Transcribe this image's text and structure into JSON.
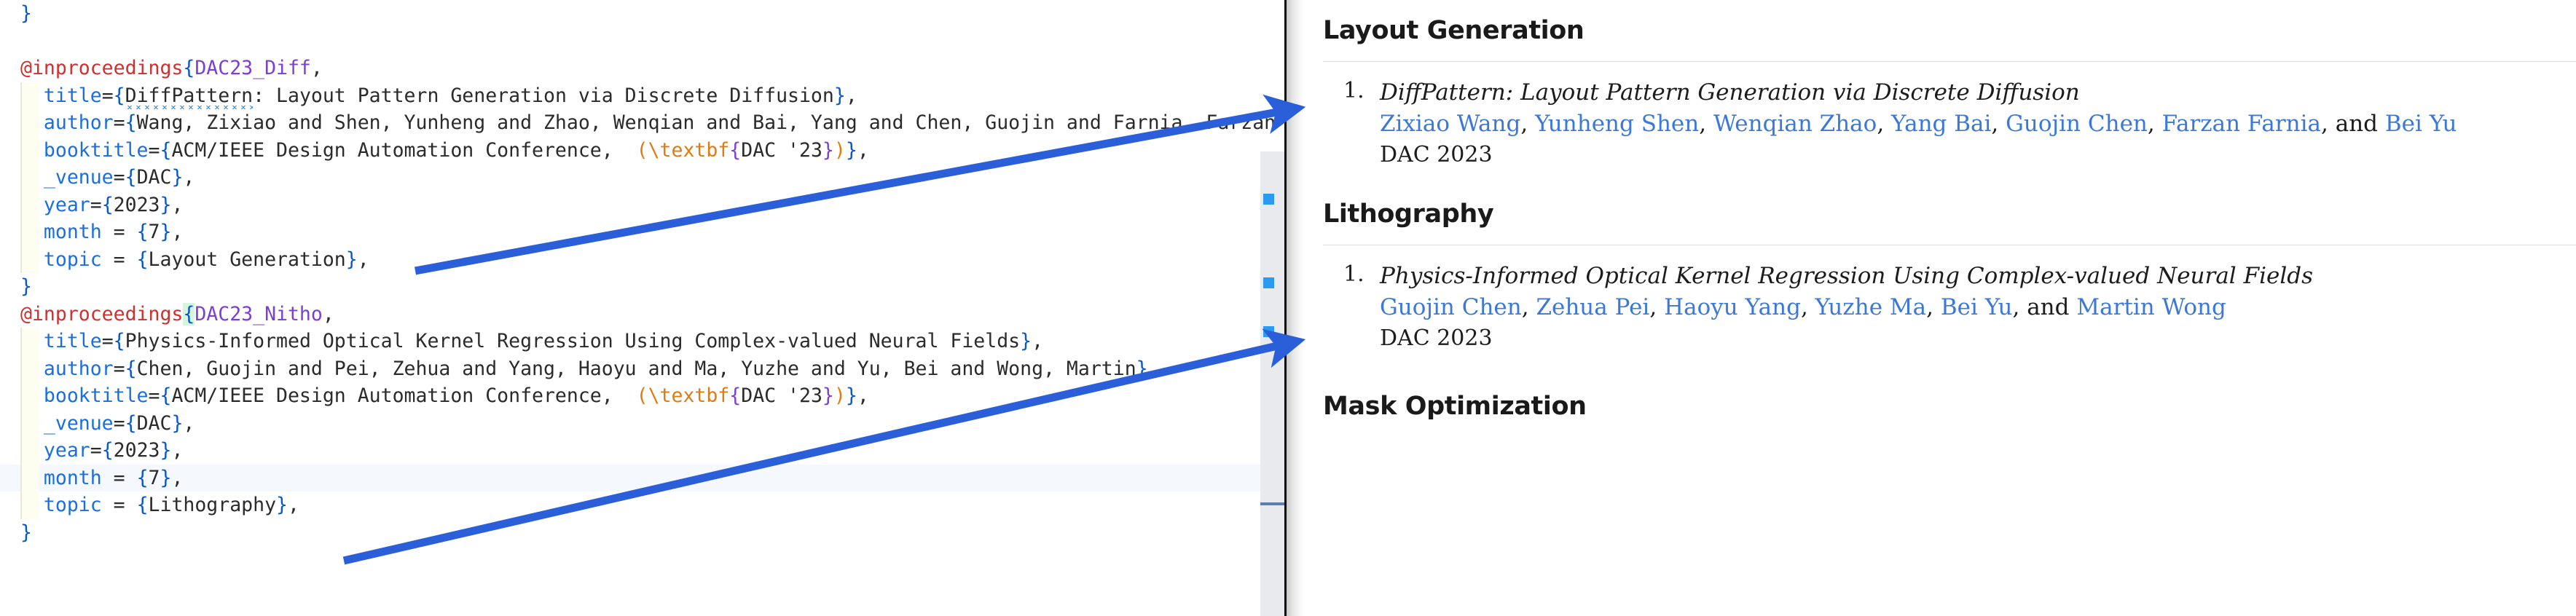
{
  "editor": {
    "entries": [
      {
        "stray_brace": "}",
        "lines": []
      }
    ],
    "code_lines": [
      {
        "id": "l0",
        "block": false,
        "selected": false,
        "segs": [
          {
            "c": "tk-brace",
            "t": "}"
          }
        ]
      },
      {
        "id": "l1",
        "block": false,
        "selected": false,
        "segs": []
      },
      {
        "id": "l2",
        "block": false,
        "selected": false,
        "segs": [
          {
            "c": "tk-at",
            "t": "@inproceedings"
          },
          {
            "c": "tk-brace",
            "t": "{"
          },
          {
            "c": "tk-key",
            "t": "DAC23_Diff"
          },
          {
            "c": "tk-plain",
            "t": ","
          }
        ]
      },
      {
        "id": "l3",
        "block": true,
        "selected": false,
        "segs": [
          {
            "c": "tk-field",
            "t": "  title"
          },
          {
            "c": "tk-plain",
            "t": "="
          },
          {
            "c": "tk-brace",
            "t": "{"
          },
          {
            "c": "tk-plain squiggle",
            "t": "DiffPattern"
          },
          {
            "c": "tk-plain",
            "t": ": Layout Pattern Generation via Discrete Diffusion"
          },
          {
            "c": "tk-brace",
            "t": "}"
          },
          {
            "c": "tk-plain",
            "t": ","
          }
        ]
      },
      {
        "id": "l4",
        "block": true,
        "selected": false,
        "segs": [
          {
            "c": "tk-field",
            "t": "  author"
          },
          {
            "c": "tk-plain",
            "t": "="
          },
          {
            "c": "tk-brace",
            "t": "{"
          },
          {
            "c": "tk-plain",
            "t": "Wang, Zixiao and Shen, Yunheng and Zhao, Wenqian and Bai, Yang and Chen, Guojin and Farnia, Farzan and Yu, Bei"
          },
          {
            "c": "tk-brace",
            "t": "}"
          },
          {
            "c": "tk-plain",
            "t": ","
          }
        ]
      },
      {
        "id": "l5",
        "block": true,
        "selected": false,
        "segs": [
          {
            "c": "tk-field",
            "t": "  booktitle"
          },
          {
            "c": "tk-plain",
            "t": "="
          },
          {
            "c": "tk-brace",
            "t": "{"
          },
          {
            "c": "tk-plain",
            "t": "ACM/IEEE Design Automation Conference,  "
          },
          {
            "c": "tk-cmd",
            "t": "(\\textbf"
          },
          {
            "c": "tk-tbrace",
            "t": "{"
          },
          {
            "c": "tk-plain",
            "t": "DAC '23"
          },
          {
            "c": "tk-tbrace",
            "t": "}"
          },
          {
            "c": "tk-cmd",
            "t": ")"
          },
          {
            "c": "tk-brace",
            "t": "}"
          },
          {
            "c": "tk-plain",
            "t": ","
          }
        ]
      },
      {
        "id": "l6",
        "block": true,
        "selected": false,
        "segs": [
          {
            "c": "tk-field",
            "t": "  _venue"
          },
          {
            "c": "tk-plain",
            "t": "="
          },
          {
            "c": "tk-brace",
            "t": "{"
          },
          {
            "c": "tk-plain",
            "t": "DAC"
          },
          {
            "c": "tk-brace",
            "t": "}"
          },
          {
            "c": "tk-plain",
            "t": ","
          }
        ]
      },
      {
        "id": "l7",
        "block": true,
        "selected": false,
        "segs": [
          {
            "c": "tk-field",
            "t": "  year"
          },
          {
            "c": "tk-plain",
            "t": "="
          },
          {
            "c": "tk-brace",
            "t": "{"
          },
          {
            "c": "tk-plain",
            "t": "2023"
          },
          {
            "c": "tk-brace",
            "t": "}"
          },
          {
            "c": "tk-plain",
            "t": ","
          }
        ]
      },
      {
        "id": "l8",
        "block": true,
        "selected": false,
        "segs": [
          {
            "c": "tk-field",
            "t": "  month"
          },
          {
            "c": "tk-plain",
            "t": " = "
          },
          {
            "c": "tk-brace",
            "t": "{"
          },
          {
            "c": "tk-plain",
            "t": "7"
          },
          {
            "c": "tk-brace",
            "t": "}"
          },
          {
            "c": "tk-plain",
            "t": ","
          }
        ]
      },
      {
        "id": "l9",
        "block": true,
        "selected": false,
        "segs": [
          {
            "c": "tk-field",
            "t": "  topic"
          },
          {
            "c": "tk-plain",
            "t": " = "
          },
          {
            "c": "tk-brace",
            "t": "{"
          },
          {
            "c": "tk-plain",
            "t": "Layout Generation"
          },
          {
            "c": "tk-brace",
            "t": "}"
          },
          {
            "c": "tk-plain",
            "t": ","
          }
        ]
      },
      {
        "id": "l10",
        "block": false,
        "selected": false,
        "segs": [
          {
            "c": "tk-brace",
            "t": "}"
          }
        ]
      },
      {
        "id": "l11",
        "block": false,
        "selected": false,
        "segs": [
          {
            "c": "tk-at",
            "t": "@inproceedings"
          },
          {
            "c": "tk-brace cursor-hl",
            "t": "{"
          },
          {
            "c": "tk-key",
            "t": "DAC23_Nitho"
          },
          {
            "c": "tk-plain",
            "t": ","
          }
        ]
      },
      {
        "id": "l12",
        "block": true,
        "selected": false,
        "segs": [
          {
            "c": "tk-field",
            "t": "  title"
          },
          {
            "c": "tk-plain",
            "t": "="
          },
          {
            "c": "tk-brace",
            "t": "{"
          },
          {
            "c": "tk-plain",
            "t": "Physics-Informed Optical Kernel Regression Using Complex-valued Neural Fields"
          },
          {
            "c": "tk-brace",
            "t": "}"
          },
          {
            "c": "tk-plain",
            "t": ","
          }
        ]
      },
      {
        "id": "l13",
        "block": true,
        "selected": false,
        "segs": [
          {
            "c": "tk-field",
            "t": "  author"
          },
          {
            "c": "tk-plain",
            "t": "="
          },
          {
            "c": "tk-brace",
            "t": "{"
          },
          {
            "c": "tk-plain",
            "t": "Chen, Guojin and Pei, Zehua and Yang, Haoyu and Ma, Yuzhe and Yu, Bei and Wong, Martin"
          },
          {
            "c": "tk-brace",
            "t": "}"
          },
          {
            "c": "tk-plain",
            "t": ","
          }
        ]
      },
      {
        "id": "l14",
        "block": true,
        "selected": false,
        "segs": [
          {
            "c": "tk-field",
            "t": "  booktitle"
          },
          {
            "c": "tk-plain",
            "t": "="
          },
          {
            "c": "tk-brace",
            "t": "{"
          },
          {
            "c": "tk-plain",
            "t": "ACM/IEEE Design Automation Conference,  "
          },
          {
            "c": "tk-cmd",
            "t": "(\\textbf"
          },
          {
            "c": "tk-tbrace",
            "t": "{"
          },
          {
            "c": "tk-plain",
            "t": "DAC '23"
          },
          {
            "c": "tk-tbrace",
            "t": "}"
          },
          {
            "c": "tk-cmd",
            "t": ")"
          },
          {
            "c": "tk-brace",
            "t": "}"
          },
          {
            "c": "tk-plain",
            "t": ","
          }
        ]
      },
      {
        "id": "l15",
        "block": true,
        "selected": false,
        "segs": [
          {
            "c": "tk-field",
            "t": "  _venue"
          },
          {
            "c": "tk-plain",
            "t": "="
          },
          {
            "c": "tk-brace",
            "t": "{"
          },
          {
            "c": "tk-plain",
            "t": "DAC"
          },
          {
            "c": "tk-brace",
            "t": "}"
          },
          {
            "c": "tk-plain",
            "t": ","
          }
        ]
      },
      {
        "id": "l16",
        "block": true,
        "selected": false,
        "segs": [
          {
            "c": "tk-field",
            "t": "  year"
          },
          {
            "c": "tk-plain",
            "t": "="
          },
          {
            "c": "tk-brace",
            "t": "{"
          },
          {
            "c": "tk-plain",
            "t": "2023"
          },
          {
            "c": "tk-brace",
            "t": "}"
          },
          {
            "c": "tk-plain",
            "t": ","
          }
        ]
      },
      {
        "id": "l17",
        "block": true,
        "selected": true,
        "segs": [
          {
            "c": "tk-field",
            "t": "  month"
          },
          {
            "c": "tk-plain",
            "t": " = "
          },
          {
            "c": "tk-brace",
            "t": "{"
          },
          {
            "c": "tk-plain",
            "t": "7"
          },
          {
            "c": "tk-brace",
            "t": "}"
          },
          {
            "c": "tk-plain",
            "t": ","
          }
        ]
      },
      {
        "id": "l18",
        "block": true,
        "selected": false,
        "segs": [
          {
            "c": "tk-field",
            "t": "  topic"
          },
          {
            "c": "tk-plain",
            "t": " = "
          },
          {
            "c": "tk-brace",
            "t": "{"
          },
          {
            "c": "tk-plain",
            "t": "Lithography"
          },
          {
            "c": "tk-brace",
            "t": "}"
          },
          {
            "c": "tk-plain",
            "t": ","
          }
        ]
      },
      {
        "id": "l19",
        "block": false,
        "selected": false,
        "segs": [
          {
            "c": "tk-brace",
            "t": "}"
          }
        ]
      }
    ],
    "scrollbar": {
      "marks": 3,
      "colors": {
        "mark": "#2b9af3",
        "track": "#e8eaed",
        "rule": "#5b7fb0"
      }
    }
  },
  "preview": {
    "sections": [
      {
        "heading": "Layout Generation",
        "publications": [
          {
            "index": "1.",
            "title": "DiffPattern: Layout Pattern Generation via Discrete Diffusion",
            "authors": [
              {
                "name": "Zixiao Wang",
                "link": true
              },
              {
                "name": "Yunheng Shen",
                "link": true
              },
              {
                "name": "Wenqian Zhao",
                "link": true
              },
              {
                "name": "Yang Bai",
                "link": true
              },
              {
                "name": "Guojin Chen",
                "link": true
              },
              {
                "name": "Farzan Farnia",
                "link": true
              },
              {
                "name": "Bei Yu",
                "link": true
              }
            ],
            "authors_text": "Zixiao Wang, Yunheng Shen, Wenqian Zhao, Yang Bai, Guojin Chen, Farzan Farnia, and Bei Yu",
            "venue": "DAC 2023"
          }
        ]
      },
      {
        "heading": "Lithography",
        "publications": [
          {
            "index": "1.",
            "title": "Physics-Informed Optical Kernel Regression Using Complex-valued Neural Fields",
            "authors": [
              {
                "name": "Guojin Chen",
                "link": true
              },
              {
                "name": "Zehua Pei",
                "link": true
              },
              {
                "name": "Haoyu Yang",
                "link": true
              },
              {
                "name": "Yuzhe Ma",
                "link": true
              },
              {
                "name": "Bei Yu",
                "link": true
              },
              {
                "name": "Martin Wong",
                "link": true
              }
            ],
            "authors_text": "Guojin Chen, Zehua Pei, Haoyu Yang, Yuzhe Ma, Bei Yu, and Martin Wong",
            "venue": "DAC 2023"
          }
        ]
      },
      {
        "heading": "Mask Optimization",
        "publications": []
      }
    ],
    "separator_and": "and"
  },
  "annotations": {
    "arrow_color": "#2a5fd9",
    "arrows": [
      {
        "name": "arrow-layout-generation",
        "from_label": "topic = {Layout Generation}",
        "to_label": "Layout Generation"
      },
      {
        "name": "arrow-lithography",
        "from_label": "topic = {Lithography}",
        "to_label": "Lithography"
      }
    ]
  },
  "colors": {
    "keyword_red": "#cf3030",
    "brace_blue": "#0a58c8",
    "citekey_purple": "#7b3fd4",
    "field_blue": "#1a6fe0",
    "command_orange": "#e07b10",
    "link_blue": "#3c78d8",
    "arrow_blue": "#2a5fd9",
    "cursor_highlight": "#d6f5dd"
  }
}
